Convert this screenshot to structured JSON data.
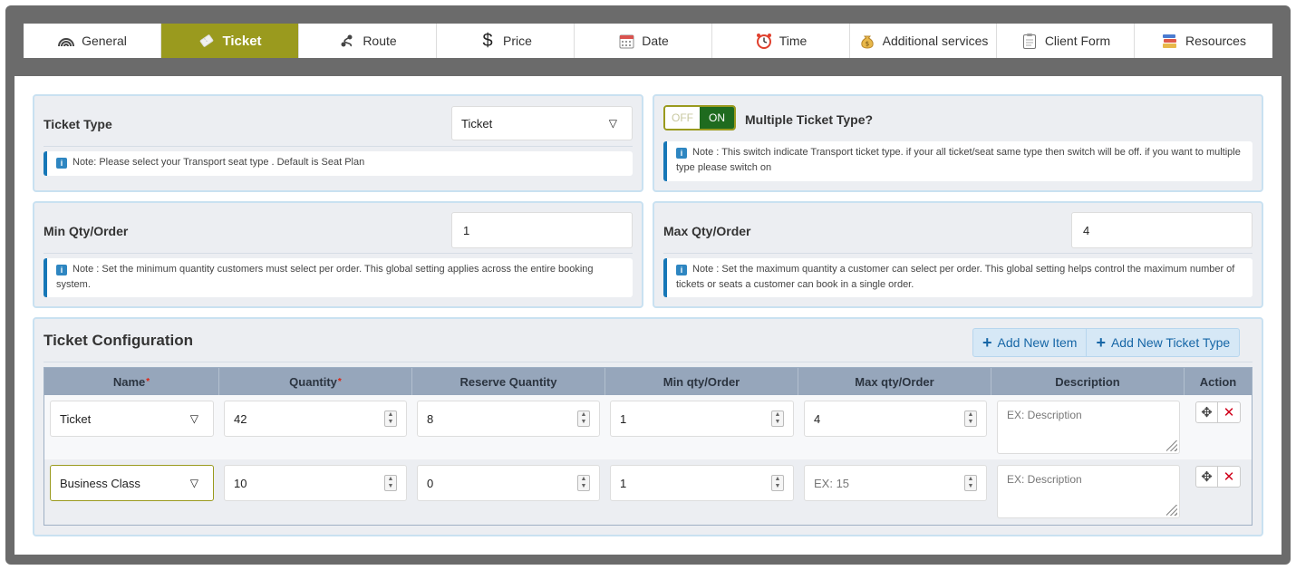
{
  "tabs": [
    {
      "label": "General",
      "icon": "broadcast-icon"
    },
    {
      "label": "Ticket",
      "icon": "ticket-icon",
      "active": true
    },
    {
      "label": "Route",
      "icon": "route-icon"
    },
    {
      "label": "Price",
      "icon": "dollar-icon"
    },
    {
      "label": "Date",
      "icon": "calendar-icon"
    },
    {
      "label": "Time",
      "icon": "alarm-clock-icon"
    },
    {
      "label": "Additional services",
      "icon": "money-bag-icon"
    },
    {
      "label": "Client Form",
      "icon": "clipboard-icon"
    },
    {
      "label": "Resources",
      "icon": "books-icon"
    }
  ],
  "ticket_type": {
    "label": "Ticket Type",
    "value": "Ticket",
    "note": "Note: Please select your Transport seat type . Default is Seat Plan"
  },
  "multiple_ticket": {
    "off_label": "OFF",
    "on_label": "ON",
    "label": "Multiple Ticket Type?",
    "note": "Note : This switch indicate Transport ticket type. if your all ticket/seat same type then switch will be off. if you want to multiple type please switch on"
  },
  "min_qty": {
    "label": "Min Qty/Order",
    "value": "1",
    "note": "Note : Set the minimum quantity customers must select per order. This global setting applies across the entire booking system."
  },
  "max_qty": {
    "label": "Max Qty/Order",
    "value": "4",
    "note": "Note : Set the maximum quantity a customer can select per order. This global setting helps control the maximum number of tickets or seats a customer can book in a single order."
  },
  "config": {
    "title": "Ticket Configuration",
    "add_item": "Add New Item",
    "add_type": "Add New Ticket Type",
    "columns": {
      "name": "Name",
      "quantity": "Quantity",
      "reserve": "Reserve Quantity",
      "min": "Min qty/Order",
      "max": "Max qty/Order",
      "description": "Description",
      "action": "Action"
    },
    "required_mark": "*",
    "rows": [
      {
        "name": "Ticket",
        "quantity": "42",
        "reserve": "8",
        "min": "1",
        "max": "4",
        "max_placeholder": "",
        "description_placeholder": "EX: Description"
      },
      {
        "name": "Business Class",
        "quantity": "10",
        "reserve": "0",
        "min": "1",
        "max": "",
        "max_placeholder": "EX: 15",
        "description_placeholder": "EX: Description"
      }
    ]
  },
  "colors": {
    "accent": "#9a9a1e",
    "on_green": "#1f6b1f",
    "link_blue": "#1666a6",
    "delete_red": "#d0021b"
  }
}
